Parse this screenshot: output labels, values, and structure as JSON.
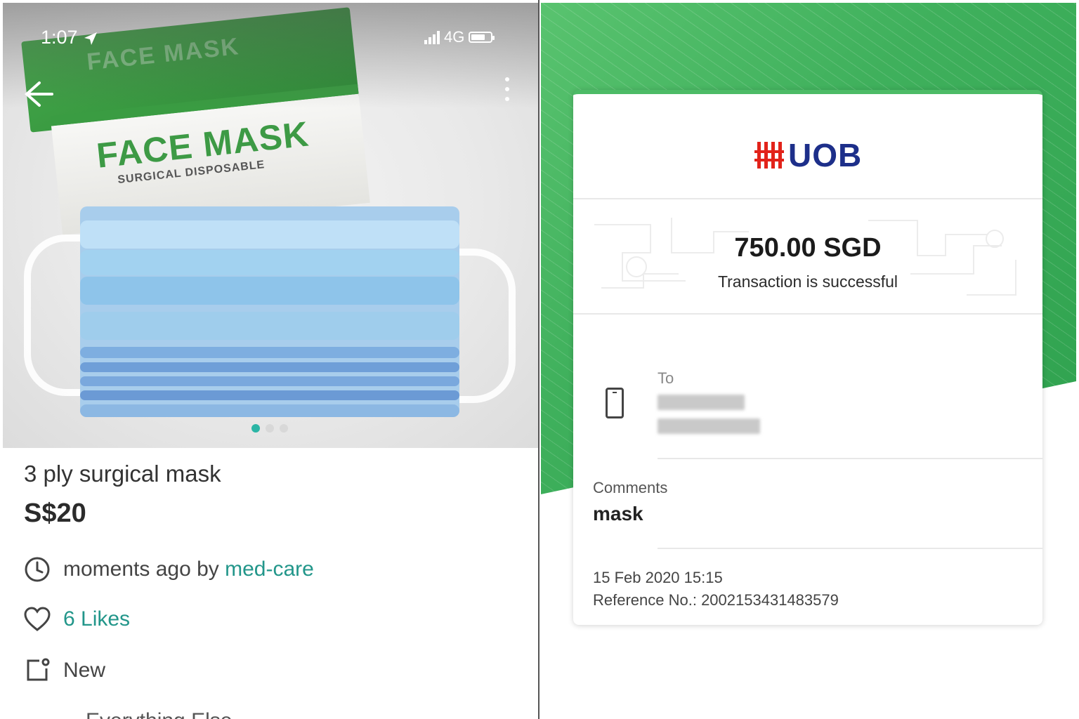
{
  "left": {
    "status_bar": {
      "time": "1:07",
      "network": "4G"
    },
    "photo": {
      "box_brand": "FACE MASK",
      "box_subtitle": "SURGICAL DISPOSABLE",
      "carousel": {
        "total": 3,
        "active": 1
      }
    },
    "listing": {
      "title": "3 ply surgical mask",
      "price": "S$20",
      "posted_prefix": "moments ago by",
      "seller": "med-care",
      "likes": "6 Likes",
      "condition": "New",
      "cut_off_row": "Everything Else"
    }
  },
  "right": {
    "bank": "UOB",
    "amount": "750.00 SGD",
    "status": "Transaction is successful",
    "to_label": "To",
    "comments_label": "Comments",
    "comments_value": "mask",
    "datetime": "15 Feb 2020 15:15",
    "reference": "Reference No.: 2002153431483579"
  },
  "colors": {
    "accent_teal": "#22968a",
    "uob_red": "#e2231a",
    "uob_blue": "#1d2f8a",
    "green_bg": "#3fb05c"
  },
  "icons": [
    "back-arrow-icon",
    "more-vertical-icon",
    "location-arrow-icon",
    "clock-icon",
    "heart-icon",
    "tag-icon",
    "phone-icon"
  ]
}
